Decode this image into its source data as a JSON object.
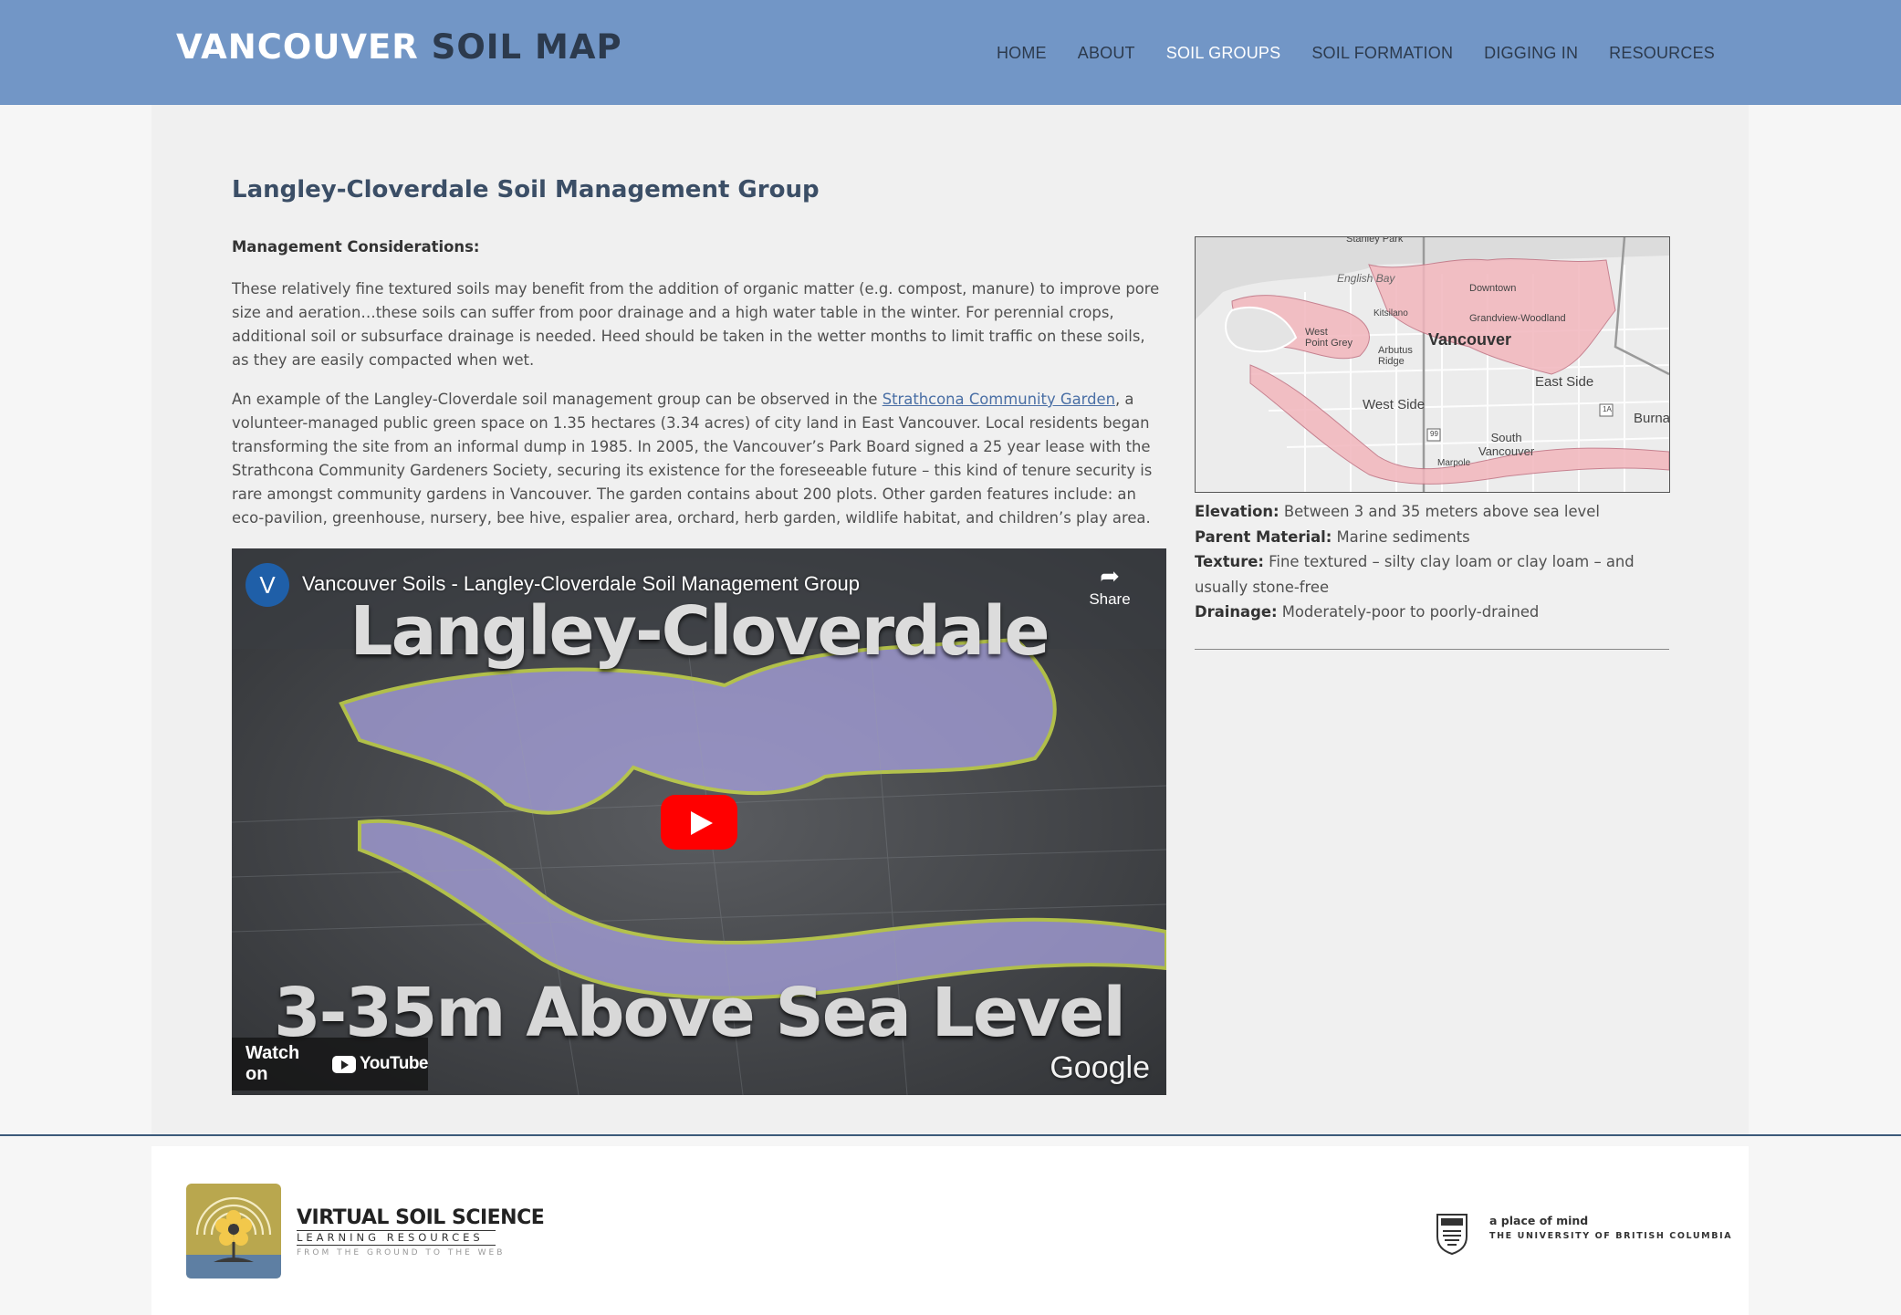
{
  "header": {
    "logo_part1": "VANCOUVER",
    "logo_part2": "SOIL MAP",
    "nav": [
      {
        "label": "HOME",
        "active": false
      },
      {
        "label": "ABOUT",
        "active": false
      },
      {
        "label": "SOIL GROUPS",
        "active": true
      },
      {
        "label": "SOIL FORMATION",
        "active": false
      },
      {
        "label": "DIGGING IN",
        "active": false
      },
      {
        "label": "RESOURCES",
        "active": false
      }
    ]
  },
  "main": {
    "title": "Langley-Cloverdale Soil Management Group",
    "subhead": "Management Considerations:",
    "paragraph1": "These relatively fine textured soils may benefit from the addition of organic matter (e.g. compost, manure) to improve pore size and aeration…these soils can suffer from poor drainage and a high water table in the winter. For perennial crops, additional soil or subsurface drainage is needed. Heed should be taken in the wetter months to limit traffic on these soils, as they are easily compacted when wet.",
    "paragraph2_before": "An example of the Langley-Cloverdale soil management group can be observed in the ",
    "paragraph2_link": "Strathcona Community Garden",
    "paragraph2_after": ", a volunteer-managed public green space on 1.35 hectares (3.34 acres) of city land in East Vancouver. Local residents began transforming the site from an informal dump in 1985. In 2005, the Vancouver’s Park Board signed a 25 year lease with the Strathcona Community Gardeners Society, securing its existence for the foreseeable future – this kind of tenure security is rare amongst community gardens in Vancouver. The garden contains about 200 plots. Other garden features include: an eco-pavilion, greenhouse, nursery, bee hive, espalier area, orchard, herb garden, wildlife habitat, and children’s play area."
  },
  "video": {
    "channel_initial": "V",
    "title": "Vancouver Soils - Langley-Cloverdale Soil Management Group",
    "share_label": "Share",
    "overlay_top": "Langley-Cloverdale",
    "overlay_bottom": "3-35m Above Sea Level",
    "watch_on": "Watch on",
    "youtube": "YouTube",
    "watermark": "Google"
  },
  "map": {
    "labels": {
      "stanley_park": "Stanley Park",
      "english_bay": "English Bay",
      "downtown": "Downtown",
      "kitsilano": "Kitsilano",
      "grandview": "Grandview-Woodland",
      "west_point_grey": "West\nPoint Grey",
      "vancouver": "Vancouver",
      "arbutus_ridge": "Arbutus\nRidge",
      "east_side": "East Side",
      "west_side": "West Side",
      "burnaby": "Burnal",
      "south_vancouver": "South\nVancouver",
      "marpole": "Marpole",
      "hwy_1a": "1A",
      "hwy_99": "99"
    }
  },
  "properties": [
    {
      "label": "Elevation:",
      "value": "Between 3 and 35 meters above sea level"
    },
    {
      "label": "Parent Material:",
      "value": "Marine sediments"
    },
    {
      "label": "Texture:",
      "value": "Fine textured – silty clay loam or clay loam – and usually stone-free"
    },
    {
      "label": "Drainage:",
      "value": "Moderately-poor to poorly-drained"
    }
  ],
  "footer": {
    "vss_line1": "VIRTUAL SOIL SCIENCE",
    "vss_line2": "LEARNING RESOURCES",
    "vss_line3": "FROM THE GROUND TO THE WEB",
    "ubc_line1": "a place of mind",
    "ubc_line2": "THE UNIVERSITY OF BRITISH COLUMBIA"
  },
  "colors": {
    "header_bg": "#7296c6",
    "soil_overlay": "#f2b6bd",
    "link": "#4a6fa5"
  }
}
